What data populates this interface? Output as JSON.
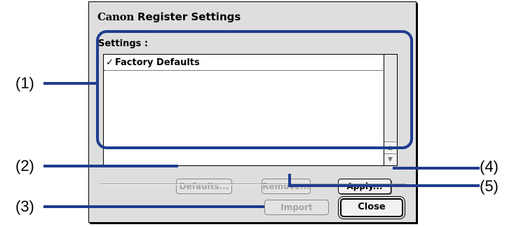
{
  "dialog": {
    "brand": "Canon",
    "title": "Register Settings",
    "settings_label": "Settings :",
    "list": {
      "items": [
        {
          "check": "✓",
          "label": "Factory Defaults",
          "selected": true
        }
      ],
      "scroll_up_icon": "triangle-up",
      "scroll_down_icon": "triangle-down"
    },
    "buttons": {
      "defaults": "Defaults...",
      "remove": "Remove...",
      "apply": "Apply...",
      "import": "Import",
      "close": "Close"
    }
  },
  "callouts": {
    "c1": "(1)",
    "c2": "(2)",
    "c3": "(3)",
    "c4": "(4)",
    "c5": "(5)"
  },
  "colors": {
    "callout_line": "#1f3d8f",
    "dialog_bg": "#dedede",
    "disabled_text": "#a4a4a4"
  }
}
